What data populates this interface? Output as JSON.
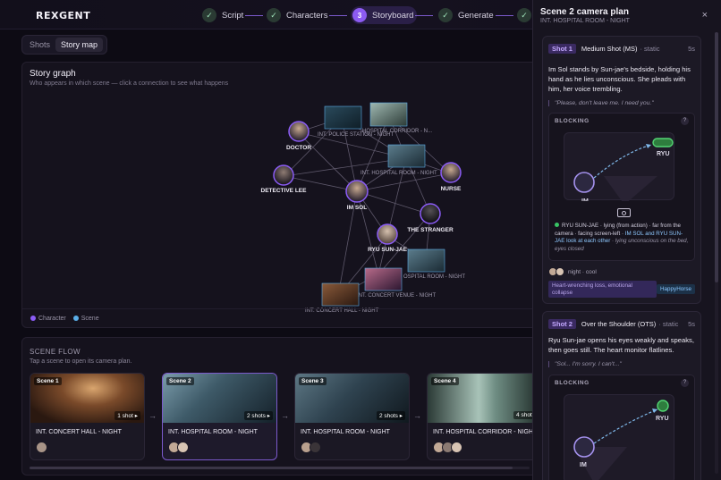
{
  "app": {
    "logo": "REXGENT"
  },
  "stepper": [
    {
      "label": "Script",
      "marker": "✓",
      "state": "done"
    },
    {
      "label": "Characters",
      "marker": "✓",
      "state": "done"
    },
    {
      "label": "Storyboard",
      "marker": "3",
      "state": "active"
    },
    {
      "label": "Generate",
      "marker": "✓",
      "state": "done"
    },
    {
      "label": "",
      "marker": "✓",
      "state": "done"
    }
  ],
  "tabs": [
    {
      "label": "Shots",
      "active": false
    },
    {
      "label": "Story map",
      "active": true
    }
  ],
  "graph": {
    "title": "Story graph",
    "subtitle": "Who appears in which scene — click a connection to see what happens",
    "characters": [
      "DOCTOR",
      "DETECTIVE LEE",
      "IM SOL",
      "NURSE",
      "THE STRANGER",
      "RYU SUN-JAE"
    ],
    "scenes": [
      "INT. POLICE STATION - NIGHT",
      "HOSPITAL CORRIDOR - N...",
      "INT. HOSPITAL ROOM - NIGHT",
      "OSPITAL ROOM - NIGHT",
      "INT. CONCERT VENUE - NIGHT",
      "INT. CONCERT HALL - NIGHT"
    ],
    "legend": {
      "character": "Character",
      "scene": "Scene"
    },
    "colors": {
      "character": "#8b5cf6",
      "scene": "#5aaee8",
      "edge": "#6a6478"
    }
  },
  "flow": {
    "title": "SCENE FLOW",
    "subtitle": "Tap a scene to open its camera plan.",
    "arrow": "→",
    "scenes": [
      {
        "tag": "Scene 1",
        "shots": "1 shot ▸",
        "name": "INT. CONCERT HALL - NIGHT",
        "selected": false
      },
      {
        "tag": "Scene 2",
        "shots": "2 shots ▸",
        "name": "INT. HOSPITAL ROOM - NIGHT",
        "selected": true
      },
      {
        "tag": "Scene 3",
        "shots": "2 shots ▸",
        "name": "INT. HOSPITAL ROOM - NIGHT",
        "selected": false
      },
      {
        "tag": "Scene 4",
        "shots": "4 shots",
        "name": "INT. HOSPITAL CORRIDOR - NIGHT",
        "selected": false
      }
    ]
  },
  "panel": {
    "title": "Scene 2 camera plan",
    "subtitle": "INT. HOSPITAL ROOM - NIGHT",
    "close": "×",
    "shots": [
      {
        "badge": "Shot 1",
        "type": "Medium Shot (MS)",
        "motion": "· static",
        "duration": "5s",
        "description": "Im Sol stands by Sun-jae's bedside, holding his hand as he lies unconscious. She pleads with him, her voice trembling.",
        "quote": "\"Please, don't leave me. I need you.\"",
        "blocking_label": "BLOCKING",
        "help": "?",
        "stage": {
          "left": "IM",
          "right": "RYU"
        },
        "note": {
          "lead": "RYU SUN-JAE · lying (from action) · far from the camera · facing screen-left · ",
          "highlight": "IM SOL and RYU SUN-JAE look at each other",
          "tail": " · lying unconscious on the bed, eyes closed"
        },
        "mood": "night · cool",
        "emotion": "Heart-wrenching loss, emotional collapse",
        "model": "HappyHorse"
      },
      {
        "badge": "Shot 2",
        "type": "Over the Shoulder (OTS)",
        "motion": "· static",
        "duration": "5s",
        "description": "Ryu Sun-jae opens his eyes weakly and speaks, then goes still. The heart monitor flatlines.",
        "quote": "\"Sol... I'm sorry. I can't...\"",
        "blocking_label": "BLOCKING",
        "help": "?",
        "stage": {
          "left": "IM",
          "right": "RYU"
        }
      }
    ]
  }
}
